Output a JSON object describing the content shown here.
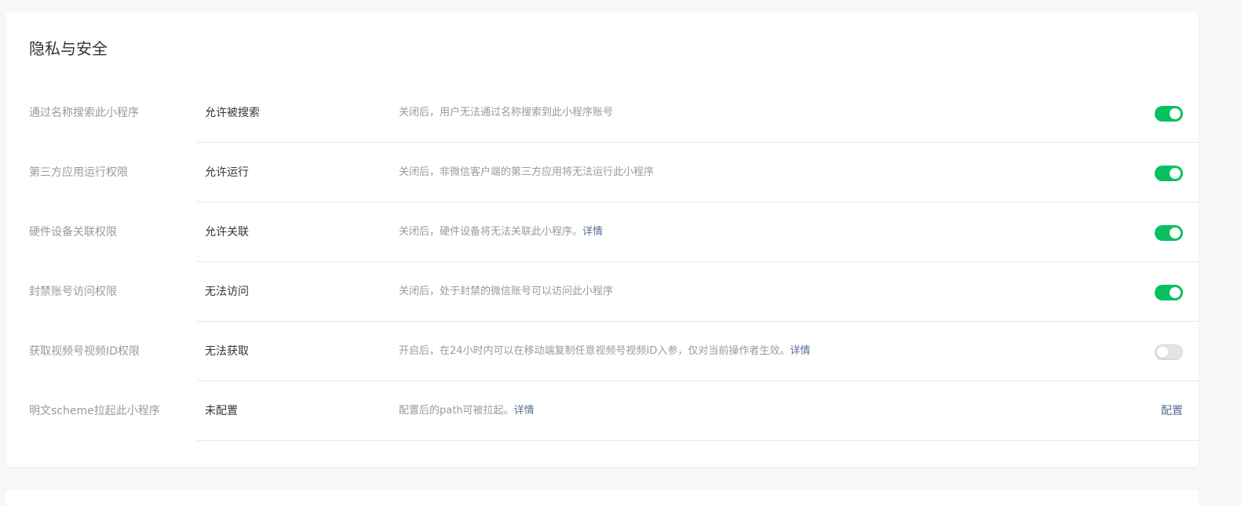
{
  "section": {
    "title": "隐私与安全"
  },
  "rows": [
    {
      "label": "通过名称搜索此小程序",
      "status": "允许被搜索",
      "desc": "关闭后，用户无法通过名称搜索到此小程序账号",
      "link": "",
      "toggle_on": true
    },
    {
      "label": "第三方应用运行权限",
      "status": "允许运行",
      "desc": "关闭后，非微信客户端的第三方应用将无法运行此小程序",
      "link": "",
      "toggle_on": true
    },
    {
      "label": "硬件设备关联权限",
      "status": "允许关联",
      "desc": "关闭后，硬件设备将无法关联此小程序。",
      "link": "详情",
      "toggle_on": true
    },
    {
      "label": "封禁账号访问权限",
      "status": "无法访问",
      "desc": "关闭后，处于封禁的微信账号可以访问此小程序",
      "link": "",
      "toggle_on": true
    },
    {
      "label": "获取视频号视频ID权限",
      "status": "无法获取",
      "desc": "开启后，在24小时内可以在移动端复制任意视频号视频ID入参，仅对当前操作者生效。",
      "link": "详情",
      "toggle_on": false
    },
    {
      "label": "明文scheme拉起此小程序",
      "status": "未配置",
      "desc": "配置后的path可被拉起。",
      "link": "详情",
      "action": "配置"
    }
  ],
  "colors": {
    "accent_green": "#07c160",
    "link_blue": "#576b95"
  }
}
